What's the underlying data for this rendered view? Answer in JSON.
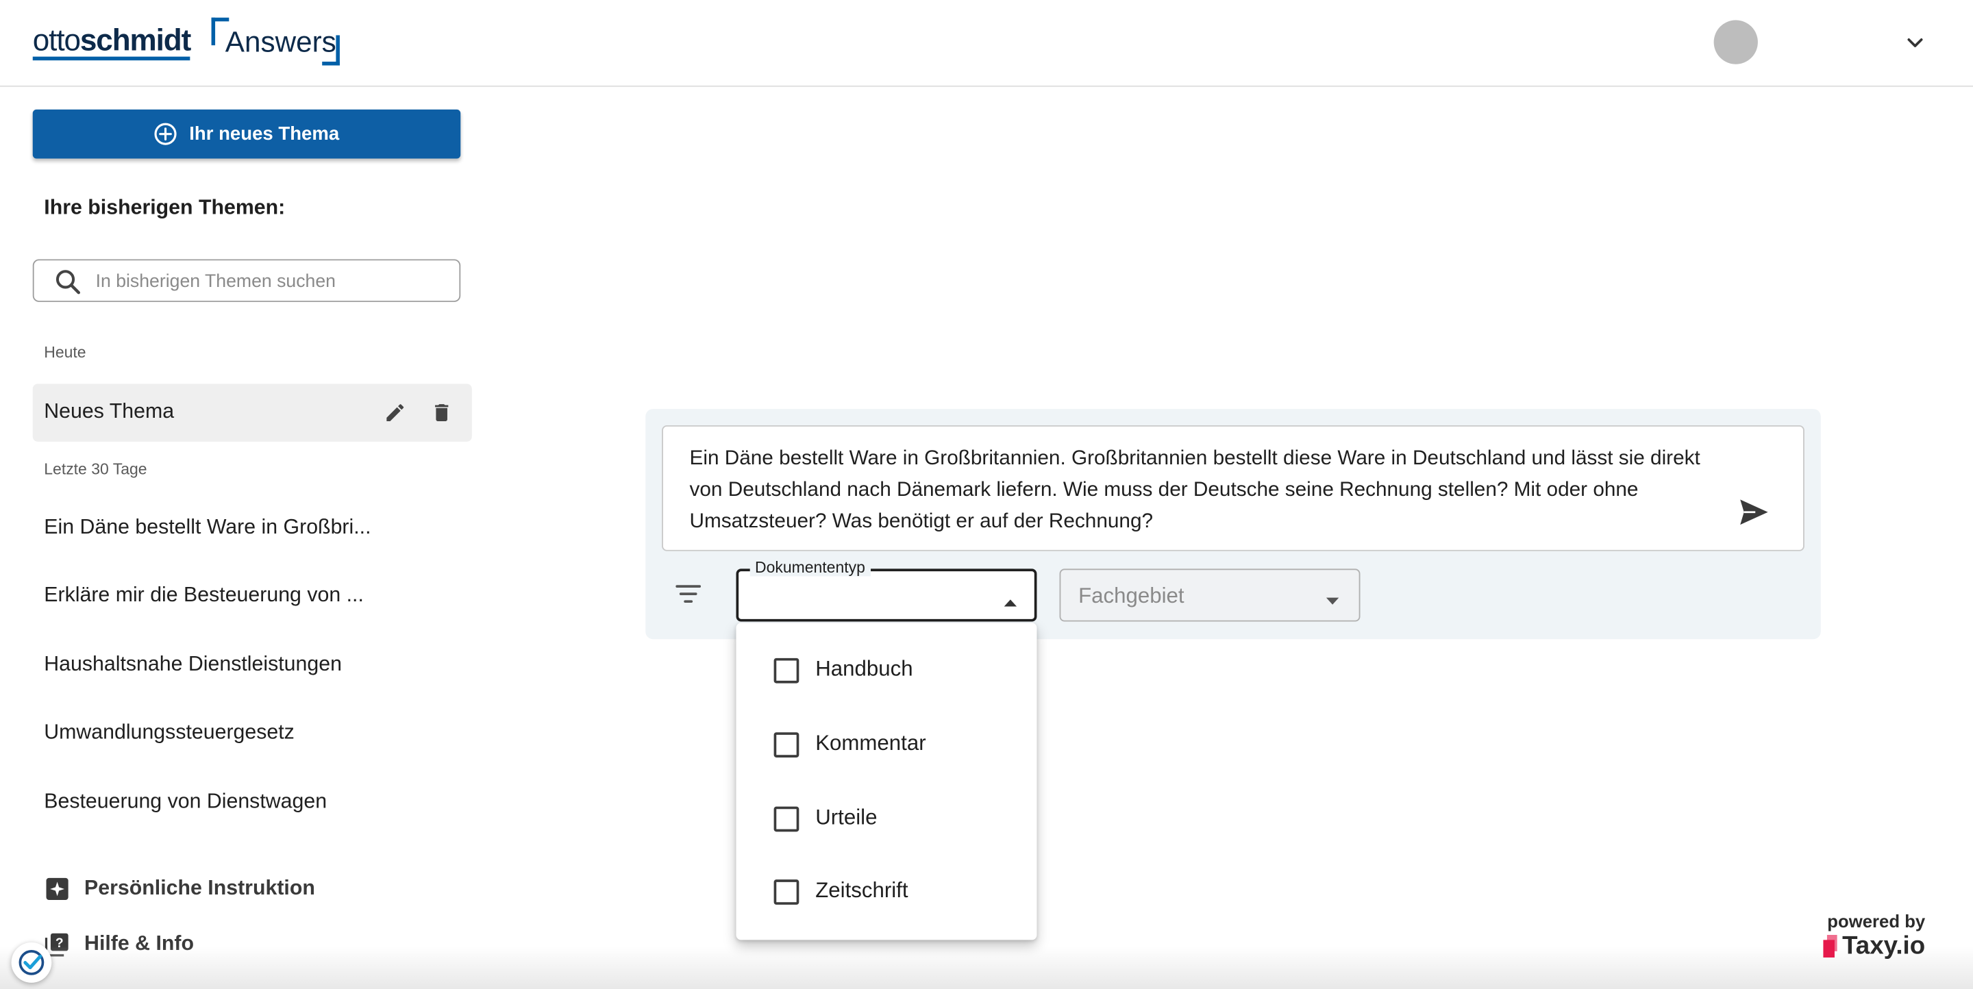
{
  "header": {
    "logo": {
      "part1": "otto",
      "part2": "schmidt",
      "product": "Answers"
    },
    "icons": {
      "avatar": "user-avatar",
      "menu": "chevron-down-icon"
    }
  },
  "sidebar": {
    "new_topic_button": "Ihr neues Thema",
    "heading": "Ihre bisherigen Themen:",
    "search_placeholder": "In bisherigen Themen suchen",
    "groups": {
      "today": {
        "label": "Heute",
        "items": [
          {
            "title": "Neues Thema",
            "active": true
          }
        ]
      },
      "last30": {
        "label": "Letzte 30 Tage",
        "items": [
          {
            "title": "Ein Däne bestellt Ware in Großbri..."
          },
          {
            "title": "Erkläre mir die Besteuerung von ..."
          },
          {
            "title": "Haushaltsnahe Dienstleistungen"
          },
          {
            "title": "Umwandlungssteuergesetz"
          },
          {
            "title": "Besteuerung von Dienstwagen"
          }
        ]
      }
    },
    "links": [
      {
        "label": "Persönliche Instruktion",
        "icon": "sparkle-box-icon"
      },
      {
        "label": "Hilfe & Info",
        "icon": "help-box-icon"
      }
    ]
  },
  "chat": {
    "question": "Ein Däne bestellt Ware in Großbritannien. Großbritannien bestellt diese Ware in Deutschland und lässt sie direkt von Deutschland nach Dänemark liefern. Wie muss der Deutsche seine Rechnung stellen? Mit oder ohne Umsatzsteuer? Was benötigt er auf der Rechnung?",
    "filters": {
      "doctype_label": "Dokumententyp",
      "doctype_value": "",
      "fachgebiet_placeholder": "Fachgebiet"
    },
    "doctype_options": [
      {
        "label": "Handbuch",
        "checked": false
      },
      {
        "label": "Kommentar",
        "checked": false
      },
      {
        "label": "Urteile",
        "checked": false
      },
      {
        "label": "Zeitschrift",
        "checked": false
      }
    ]
  },
  "footer": {
    "powered_by": "powered by",
    "brand": "Taxy.io"
  },
  "colors": {
    "brand_blue": "#0e5fa5",
    "logo_navy": "#0d2a4a",
    "panel_bg": "#eff4f7",
    "taxy_pink": "#e6194b"
  }
}
